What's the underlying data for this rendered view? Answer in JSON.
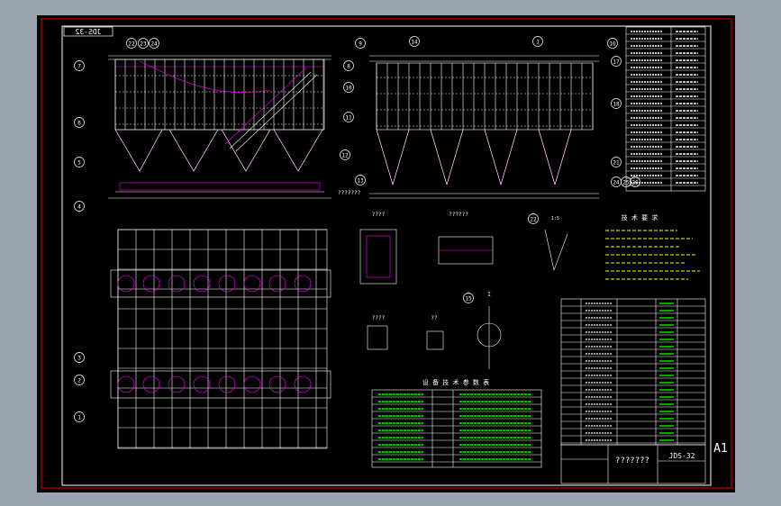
{
  "drawing": {
    "number_mirrored": "JDS-32",
    "number": "JDS-32",
    "sheet_size": "A1",
    "title_cell": "???????",
    "top_right_table_label": "???????",
    "callouts_top_left": [
      "22",
      "23",
      "24",
      "7",
      "6",
      "5",
      "4",
      "8",
      "10",
      "11"
    ],
    "callouts_top_right": [
      "9",
      "14",
      "16",
      "17",
      "18",
      "21",
      "13",
      "12",
      "24",
      "25",
      "26",
      "1"
    ],
    "callouts_plan": [
      "3",
      "2",
      "1"
    ],
    "callout_nozzle": "15",
    "callout_detail": "22",
    "section_a": "A",
    "section_a_label": "I",
    "section_b_label": "1:5",
    "notes_title": "技 术 要 求",
    "table_title": "设 备 技 术 参 数 表",
    "detail_titles": [
      "????",
      "??????",
      "????",
      "??"
    ]
  },
  "colors": {
    "background": "#000000",
    "border": "#ff0000",
    "outer": "#9ba3b0",
    "lines": "#ffffff",
    "accent": "#ff00ff",
    "green": "#00ff00",
    "yellow": "#ffff00"
  }
}
